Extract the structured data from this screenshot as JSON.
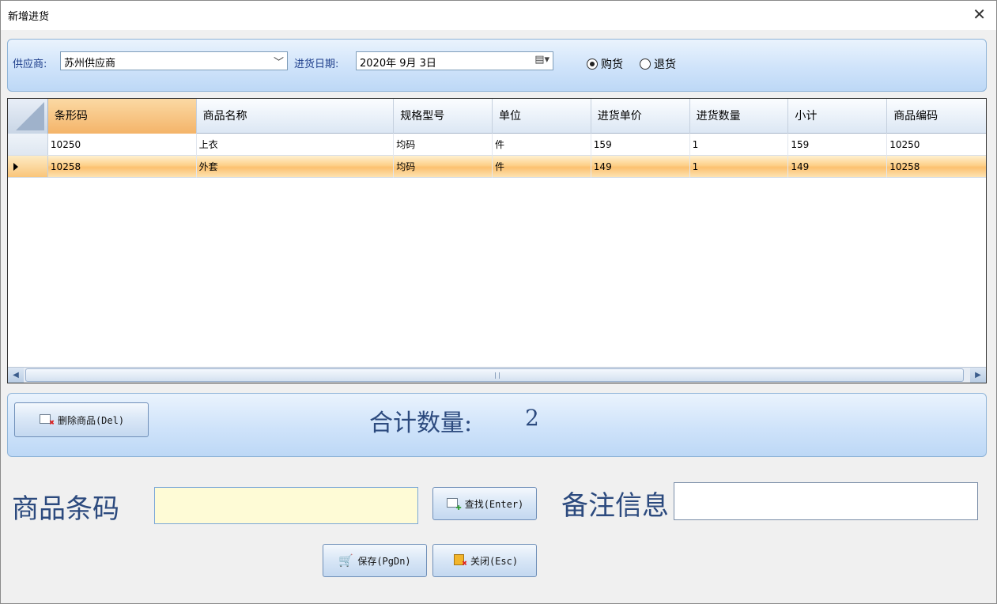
{
  "window": {
    "title": "新增进货"
  },
  "top": {
    "supplier_label": "供应商:",
    "supplier_value": "苏州供应商",
    "date_label": "进货日期:",
    "date_value": "2020年 9月 3日",
    "radio_buy": "购货",
    "radio_return": "退货",
    "radio_selected": "购货"
  },
  "grid": {
    "columns": [
      "条形码",
      "商品名称",
      "规格型号",
      "单位",
      "进货单价",
      "进货数量",
      "小计",
      "商品编码"
    ],
    "rows": [
      [
        "10250",
        "上衣",
        "均码",
        "件",
        "159",
        "1",
        "159",
        "10250"
      ],
      [
        "10258",
        "外套",
        "均码",
        "件",
        "149",
        "1",
        "149",
        "10258"
      ]
    ],
    "active_row": 1
  },
  "bottom": {
    "delete_button": "删除商品(Del)",
    "total_label": "合计数量:",
    "total_value": "2"
  },
  "form": {
    "barcode_label": "商品条码",
    "barcode_value": "",
    "find_button": "查找(Enter)",
    "remark_label": "备注信息",
    "remark_value": "",
    "save_button": "保存(PgDn)",
    "close_button": "关闭(Esc)"
  }
}
